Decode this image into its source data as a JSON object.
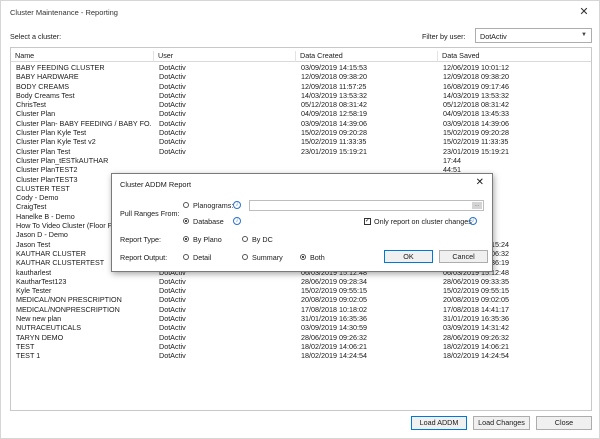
{
  "window": {
    "title": "Cluster Maintenance - Reporting",
    "close_glyph": "✕"
  },
  "toolbar": {
    "select_label": "Select a cluster:",
    "filter_label": "Filter by user:",
    "filter_value": "DotActiv"
  },
  "grid": {
    "columns": [
      "Name",
      "User",
      "Data Created",
      "Data Saved"
    ],
    "rows": [
      [
        "BABY FEEDING CLUSTER",
        "DotActiv",
        "03/09/2019 14:15:53",
        "12/06/2019 10:01:12"
      ],
      [
        "BABY HARDWARE",
        "DotActiv",
        "12/09/2018 09:38:20",
        "12/09/2018 09:38:20"
      ],
      [
        "BODY CREAMS",
        "DotActiv",
        "12/09/2018 11:57:25",
        "16/08/2019 09:17:46"
      ],
      [
        "Body Creams Test",
        "DotActiv",
        "14/03/2019 13:53:32",
        "14/03/2019 13:53:32"
      ],
      [
        "ChrisTest",
        "DotActiv",
        "05/12/2018 08:31:42",
        "05/12/2018 08:31:42"
      ],
      [
        "Cluster Plan",
        "DotActiv",
        "04/09/2018 12:58:19",
        "04/09/2018 13:45:33"
      ],
      [
        "Cluster Plan- BABY FEEDING / BABY FO...",
        "DotActiv",
        "03/09/2018 14:39:06",
        "03/09/2018 14:39:06"
      ],
      [
        "Cluster Plan Kyle Test",
        "DotActiv",
        "15/02/2019 09:20:28",
        "15/02/2019 09:20:28"
      ],
      [
        "Cluster Plan Kyle Test v2",
        "DotActiv",
        "15/02/2019 11:33:35",
        "15/02/2019 11:33:35"
      ],
      [
        "Cluster Plan Test",
        "DotActiv",
        "23/01/2019 15:19:21",
        "23/01/2019 15:19:21"
      ],
      [
        "Cluster Plan_tESTkAUTHAR",
        "",
        "",
        "17:44"
      ],
      [
        "Cluster PlanTEST2",
        "",
        "",
        "44:51"
      ],
      [
        "Cluster PlanTEST3",
        "",
        "",
        "32:23"
      ],
      [
        "CLUSTER TEST",
        "",
        "",
        "35:42"
      ],
      [
        "Cody - Demo",
        "",
        "",
        "45:39"
      ],
      [
        "CraigTest",
        "",
        "",
        "01:37"
      ],
      [
        "Hanelke B - Demo",
        "",
        "",
        "34:28"
      ],
      [
        "How To Video Cluster (Floor Pla",
        "",
        "",
        "01:38"
      ],
      [
        "Jason D - Demo",
        "",
        "",
        "34:26"
      ],
      [
        "Jason Test",
        "DotActiv",
        "24/10/2018 14:15:24",
        "24/10/2018 14:15:24"
      ],
      [
        "KAUTHAR CLUSTER",
        "DotActiv",
        "15/08/2018 12:04:54",
        "15/08/2018 12:06:32"
      ],
      [
        "KAUTHAR CLUSTERTEST",
        "DotActiv",
        "15/08/2018 12:08:30",
        "04/12/2018 16:36:19"
      ],
      [
        "kautharlest",
        "DotActiv",
        "06/03/2019 15:12:48",
        "06/03/2019 15:12:48"
      ],
      [
        "KautharTest123",
        "DotActiv",
        "28/06/2019 09:28:34",
        "28/06/2019 09:33:35"
      ],
      [
        "Kyle Tester",
        "DotActiv",
        "15/02/2019 09:55:15",
        "15/02/2019 09:55:15"
      ],
      [
        "MEDICAL/NON PRESCRIPTION",
        "DotActiv",
        "20/08/2019 09:02:05",
        "20/08/2019 09:02:05"
      ],
      [
        "MEDICAL/NONPRESCRIPTION",
        "DotActiv",
        "17/08/2018 10:18:02",
        "17/08/2018 14:41:17"
      ],
      [
        "New new plan",
        "DotActiv",
        "31/01/2019 16:35:36",
        "31/01/2019 16:35:36"
      ],
      [
        "NUTRACEUTICALS",
        "DotActiv",
        "03/09/2019 14:30:59",
        "03/09/2019 14:31:42"
      ],
      [
        "TARYN DEMO",
        "DotActiv",
        "28/06/2019 09:26:32",
        "28/06/2019 09:26:32"
      ],
      [
        "TEST",
        "DotActiv",
        "18/02/2019 14:06:21",
        "18/02/2019 14:06:21"
      ],
      [
        "TEST 1",
        "DotActiv",
        "18/02/2019 14:24:54",
        "18/02/2019 14:24:54"
      ]
    ]
  },
  "buttons": {
    "load_addm": "Load ADDM",
    "load_changes": "Load Changes",
    "close": "Close"
  },
  "dialog": {
    "title": "Cluster ADDM Report",
    "close_glyph": "✕",
    "pull_ranges_label": "Pull Ranges From:",
    "planograms_label": "Planograms:",
    "database_label": "Database",
    "only_report_label": "Only report on cluster changes",
    "only_report_checked": "✓",
    "report_type_label": "Report Type:",
    "by_plano_label": "By Plano",
    "by_dc_label": "By DC",
    "report_output_label": "Report Output:",
    "detail_label": "Detail",
    "summary_label": "Summary",
    "both_label": "Both",
    "ok_label": "OK",
    "cancel_label": "Cancel",
    "info_glyph": "i",
    "browse_glyph": "..."
  }
}
